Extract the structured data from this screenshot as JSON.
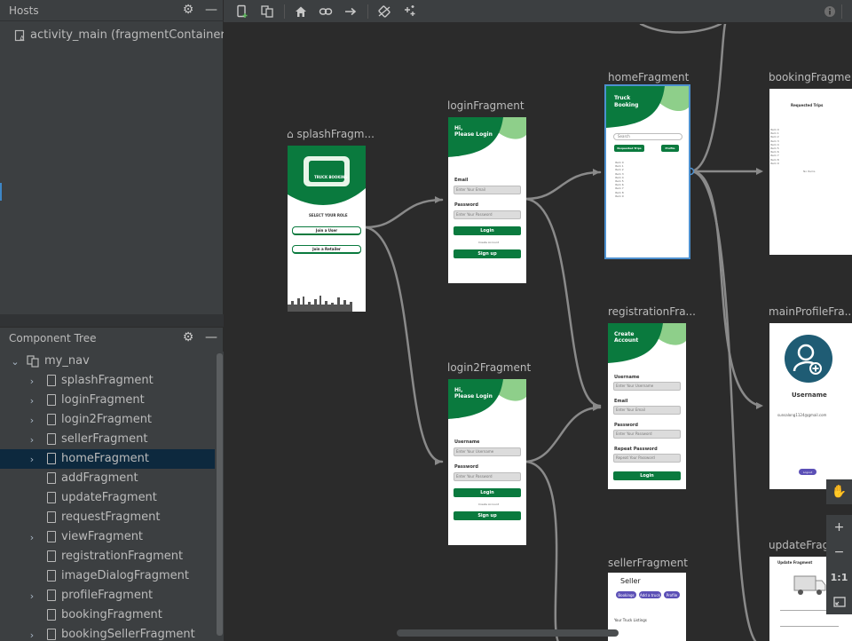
{
  "hosts": {
    "title": "Hosts",
    "item": "activity_main (fragmentContainerView"
  },
  "component_tree": {
    "title": "Component Tree",
    "root": "my_nav",
    "items": [
      {
        "label": "splashFragment",
        "expandable": true,
        "selected": false
      },
      {
        "label": "loginFragment",
        "expandable": true,
        "selected": false
      },
      {
        "label": "login2Fragment",
        "expandable": true,
        "selected": false
      },
      {
        "label": "sellerFragment",
        "expandable": true,
        "selected": false
      },
      {
        "label": "homeFragment",
        "expandable": true,
        "selected": true
      },
      {
        "label": "addFragment",
        "expandable": false,
        "selected": false
      },
      {
        "label": "updateFragment",
        "expandable": false,
        "selected": false
      },
      {
        "label": "requestFragment",
        "expandable": false,
        "selected": false
      },
      {
        "label": "viewFragment",
        "expandable": true,
        "selected": false
      },
      {
        "label": "registrationFragment",
        "expandable": false,
        "selected": false
      },
      {
        "label": "imageDialogFragment",
        "expandable": false,
        "selected": false
      },
      {
        "label": "profileFragment",
        "expandable": true,
        "selected": false
      },
      {
        "label": "bookingFragment",
        "expandable": false,
        "selected": false
      },
      {
        "label": "bookingSellerFragment",
        "expandable": true,
        "selected": false
      }
    ]
  },
  "fragments": {
    "splash": {
      "title": "splashFragm...",
      "logo_text": "TRUCK BOOKING",
      "select_role": "SELECT YOUR ROLE",
      "btn_user": "Join a User",
      "btn_retailer": "Join a Retailer"
    },
    "login": {
      "title": "loginFragment",
      "heading_1": "Hi,",
      "heading_2": "Please Login",
      "email_label": "Email",
      "email_ph": "Enter Your Email",
      "password_label": "Password",
      "password_ph": "Enter Your Password",
      "login_btn": "Login",
      "create_account": "Create Account",
      "signup_btn": "Sign up"
    },
    "login2": {
      "title": "login2Fragment",
      "heading_1": "Hi,",
      "heading_2": "Please Login",
      "username_label": "Username",
      "username_ph": "Enter Your Username",
      "password_label": "Password",
      "password_ph": "Enter Your Password",
      "login_btn": "Login",
      "create_account": "Create Account",
      "signup_btn": "Sign up"
    },
    "home": {
      "title": "homeFragment",
      "heading_1": "Truck",
      "heading_2": "Booking",
      "search_ph": "Search",
      "btn_requested": "Requested Trips",
      "btn_profile": "Profile",
      "items": [
        "Item 0",
        "Item 1",
        "Item 2",
        "Item 3",
        "Item 4",
        "Item 5",
        "Item 6",
        "Item 7",
        "Item 8",
        "Item 9"
      ]
    },
    "registration": {
      "title": "registrationFra...",
      "heading_1": "Create",
      "heading_2": "Account",
      "username_label": "Username",
      "username_ph": "Enter Your Username",
      "email_label": "Email",
      "email_ph": "Enter Your Email",
      "password_label": "Password",
      "password_ph": "Enter Your Password",
      "repeat_label": "Repeat Password",
      "repeat_ph": "Repeat Your Password",
      "login_btn": "Login"
    },
    "seller": {
      "title": "sellerFragment",
      "heading": "Seller",
      "chip_1": "Bookings",
      "chip_2": "Add a truck",
      "chip_3": "Profile",
      "listings": "Your Truck Listings"
    },
    "booking": {
      "title": "bookingFragment",
      "heading": "Requested Trips",
      "items": [
        "Item 0",
        "Item 1",
        "Item 2",
        "Item 3",
        "Item 4",
        "Item 5",
        "Item 6",
        "Item 7",
        "Item 8",
        "Item 9"
      ],
      "empty": "No Items"
    },
    "main_profile": {
      "title": "mainProfileFra...",
      "username": "Username",
      "email": "sunsalong1124@gmail.com",
      "logout": "Logout"
    },
    "update": {
      "title": "updateFragm...",
      "heading": "Update Fragment"
    }
  },
  "colors": {
    "brand_green": "#0a7a3e",
    "light_green": "#8ecf8a",
    "selection_blue": "#4d90cf",
    "profile_teal": "#1f5c74",
    "accent_purple": "#5b4fb6"
  },
  "icons": {
    "toolbar": [
      "new-destination-icon",
      "copy-icon",
      "home-icon",
      "link-icon",
      "arrow-icon",
      "rotate-icon",
      "magic-icon",
      "info-icon"
    ],
    "zoom": [
      "pan-hand-icon",
      "zoom-in-icon",
      "zoom-out-icon",
      "actual-size-icon",
      "fit-screen-icon"
    ]
  },
  "zoom": {
    "actual_size": "1:1"
  }
}
